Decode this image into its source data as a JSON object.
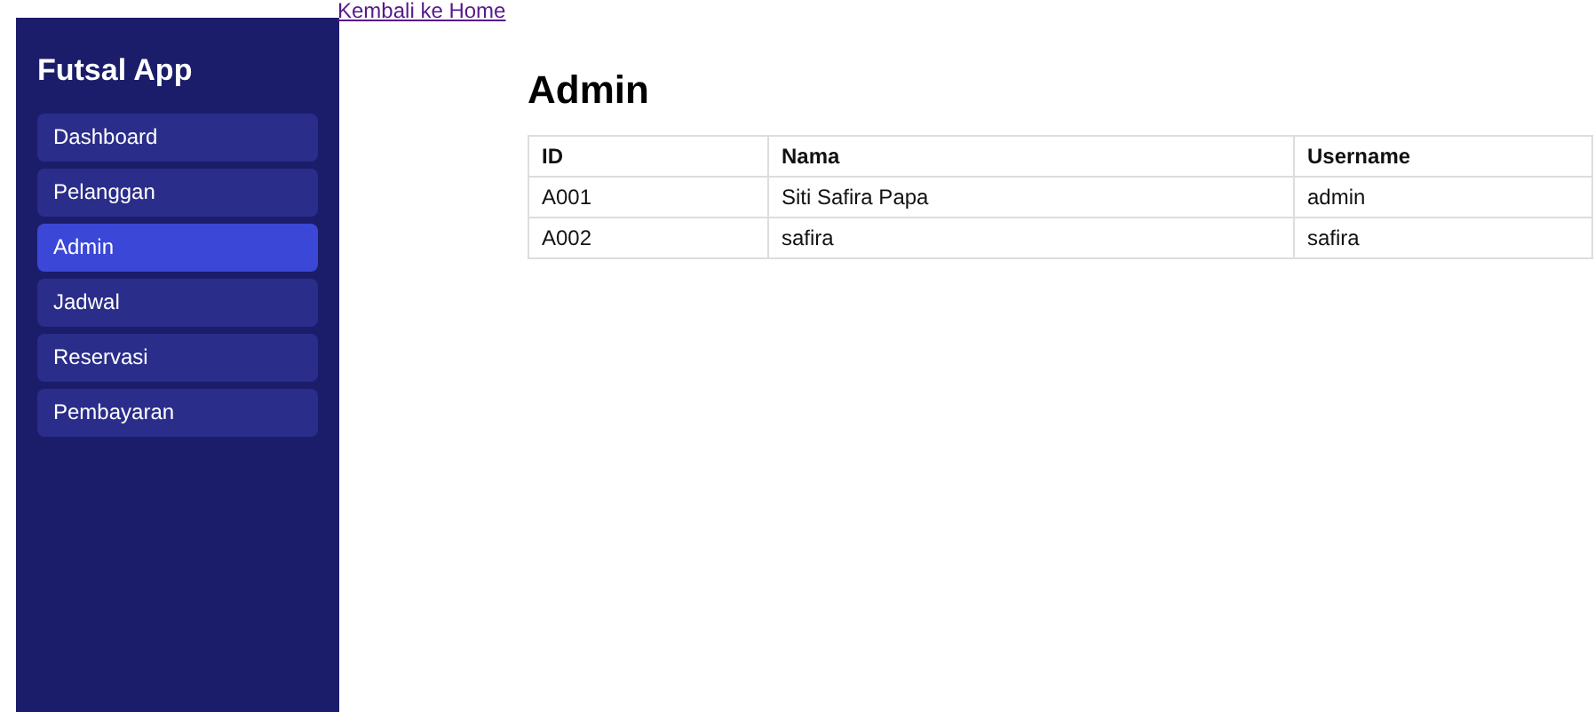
{
  "back_link": "Kembali ke Home",
  "sidebar": {
    "title": "Futsal App",
    "items": [
      {
        "label": "Dashboard",
        "selected": false
      },
      {
        "label": "Pelanggan",
        "selected": false
      },
      {
        "label": "Admin",
        "selected": true
      },
      {
        "label": "Jadwal",
        "selected": false
      },
      {
        "label": "Reservasi",
        "selected": false
      },
      {
        "label": "Pembayaran",
        "selected": false
      }
    ]
  },
  "heading": "Admin",
  "table": {
    "columns": [
      "ID",
      "Nama",
      "Username"
    ],
    "rows": [
      [
        "A001",
        "Siti Safira Papa",
        "admin"
      ],
      [
        "A002",
        "safira",
        "safira"
      ]
    ]
  }
}
